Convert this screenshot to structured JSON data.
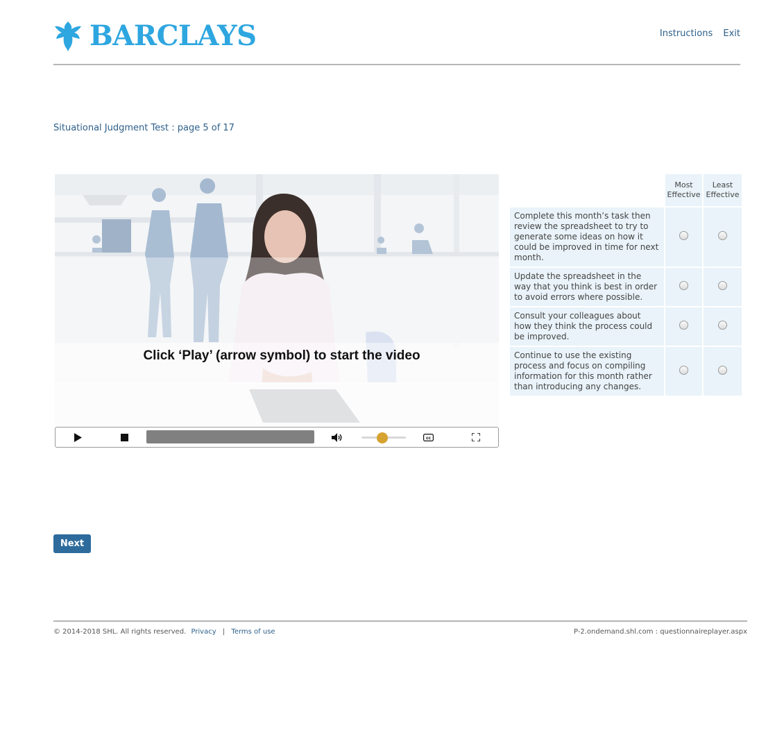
{
  "header": {
    "logo_text": "BARCLAYS",
    "links": {
      "instructions": "Instructions",
      "exit": "Exit"
    }
  },
  "page_title": "Situational Judgment Test : page 5 of 17",
  "video": {
    "caption": "Click ‘Play’ (arrow symbol) to start the video",
    "controls": [
      "play-icon",
      "stop-icon",
      "progress-bar",
      "volume-icon",
      "volume-slider",
      "closed-captions-icon",
      "fullscreen-icon"
    ],
    "volume_level": 0.5
  },
  "options": {
    "columns": [
      "Most Effective",
      "Least Effective"
    ],
    "column_lines": [
      [
        "Most",
        "Effective"
      ],
      [
        "Least",
        "Effective"
      ]
    ],
    "rows": [
      "Complete this month’s task then review the spreadsheet to try to generate some ideas on how it could be improved in time for next month.",
      "Update the spreadsheet in the way that you think is best in order to avoid errors where possible.",
      "Consult your colleagues about how they think the process could be improved.",
      "Continue to use the existing process and focus on compiling information for this month rather than introducing any changes."
    ]
  },
  "next_label": "Next",
  "footer": {
    "copyright": "© 2014-2018 SHL. All rights reserved.",
    "privacy": "Privacy",
    "separator": "|",
    "terms": "Terms of use",
    "server": "P-2.ondemand.shl.com : questionnaireplayer.aspx"
  },
  "colors": {
    "brand_blue": "#2ea6e0",
    "link_blue": "#2d5f8a",
    "button_blue": "#2d6b9c",
    "row_bg": "#e9f3f9",
    "volume_knob": "#d6a230"
  }
}
